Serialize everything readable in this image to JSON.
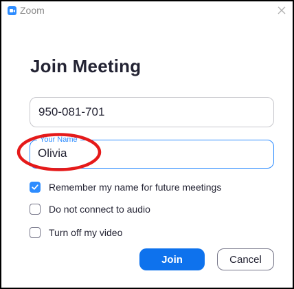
{
  "window": {
    "title": "Zoom",
    "app_icon": "zoom-camera-icon",
    "close_icon": "close-icon"
  },
  "dialog": {
    "heading": "Join Meeting",
    "meeting_id": {
      "value": "950-081-701"
    },
    "name_field": {
      "label": "Your Name",
      "value": "Olivia",
      "focused": true
    },
    "options": [
      {
        "label": "Remember my name for future meetings",
        "checked": true
      },
      {
        "label": "Do not connect to audio",
        "checked": false
      },
      {
        "label": "Turn off my video",
        "checked": false
      }
    ],
    "buttons": {
      "join": "Join",
      "cancel": "Cancel"
    }
  },
  "annotation": {
    "shape": "ellipse",
    "color": "#E51A1A",
    "target": "name_field"
  },
  "colors": {
    "accent": "#2D8CFF",
    "primary_button": "#0E72ED",
    "text": "#232333"
  }
}
